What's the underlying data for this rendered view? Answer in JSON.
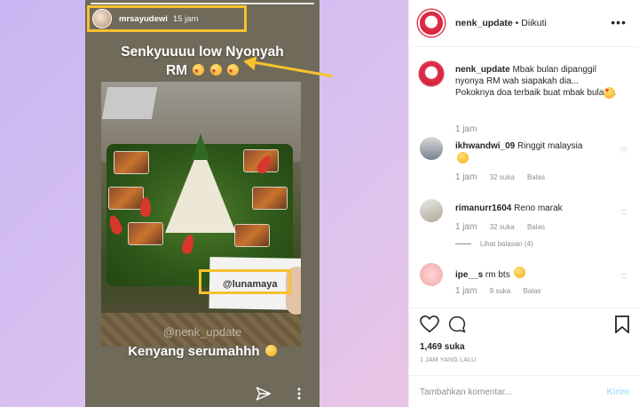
{
  "story": {
    "username": "mrsayudewi",
    "time": "15 jam",
    "caption_line1": "Senkyuuuu low Nyonyah",
    "caption_line2": "RM",
    "card_tag": "@lunamaya",
    "watermark": "@nenk_update",
    "footer": "Kenyang serumahhh"
  },
  "post": {
    "username": "nenk_update",
    "follow_status": "Diikuti",
    "caption": {
      "user": "nenk_update",
      "text": "Mbak bulan dipanggil nyonya RM wah siapakah dia... Pokoknya doa terbaik buat mbak bulan...",
      "time": "1 jam"
    },
    "comments": [
      {
        "user": "ikhwandwi_09",
        "text": "Ringgit malaysia",
        "time": "1 jam",
        "likes": "32 suka",
        "reply": "Balas"
      },
      {
        "user": "rimanurr1604",
        "text": "Reno marak",
        "time": "1 jam",
        "likes": "32 suka",
        "reply": "Balas",
        "view_replies": "Lihat balasan (4)"
      },
      {
        "user": "ipe__s",
        "text": "rm bts",
        "time": "1 jam",
        "likes": "9 suka",
        "reply": "Balas"
      }
    ],
    "likes": "1,469 suka",
    "time_ago": "1 JAM YANG LALU",
    "comment_placeholder": "Tambahkan komentar...",
    "post_button": "Kirim"
  },
  "colors": {
    "highlight": "#f7c12e",
    "avatar_red": "#e0324a",
    "link_disabled": "#b2dffc"
  }
}
